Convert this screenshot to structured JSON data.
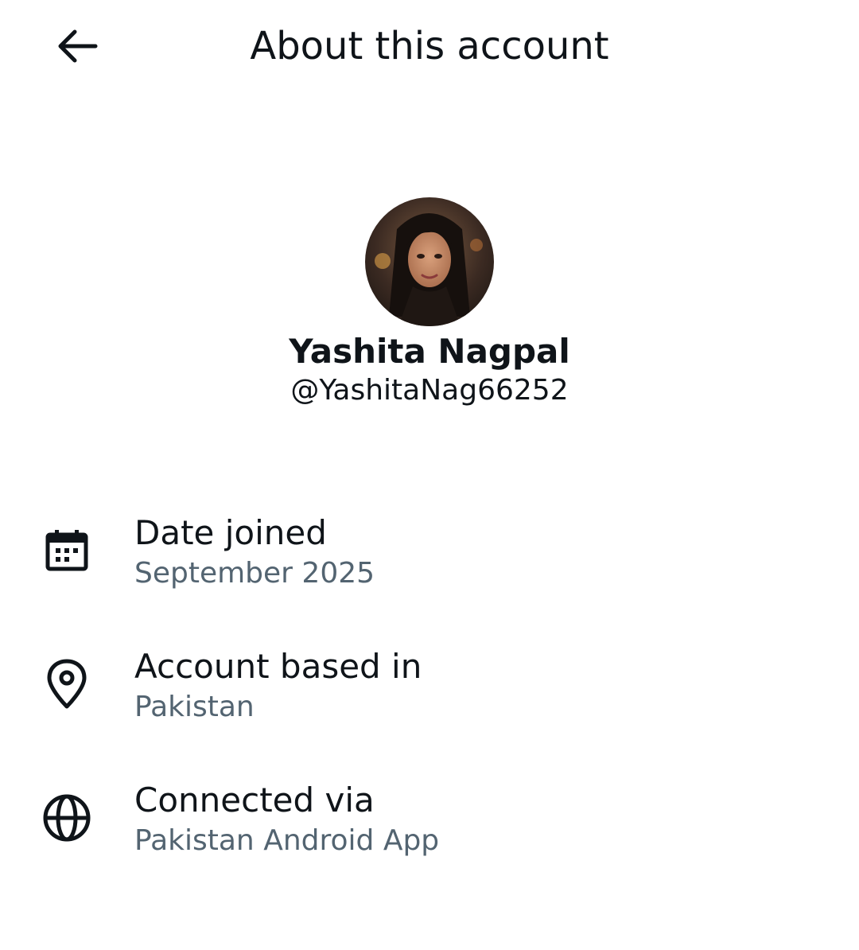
{
  "header": {
    "title": "About this account",
    "back_icon": "arrow-left-icon"
  },
  "profile": {
    "name": "Yashita Nagpal",
    "handle": "@YashitaNag66252",
    "avatar_icon": "profile-photo"
  },
  "info": [
    {
      "icon": "calendar-icon",
      "label": "Date joined",
      "value": "September 2025"
    },
    {
      "icon": "location-pin-icon",
      "label": "Account based in",
      "value": "Pakistan"
    },
    {
      "icon": "globe-icon",
      "label": "Connected via",
      "value": "Pakistan Android App"
    }
  ],
  "colors": {
    "text_primary": "#0f1419",
    "text_secondary": "#536471",
    "background": "#ffffff"
  }
}
